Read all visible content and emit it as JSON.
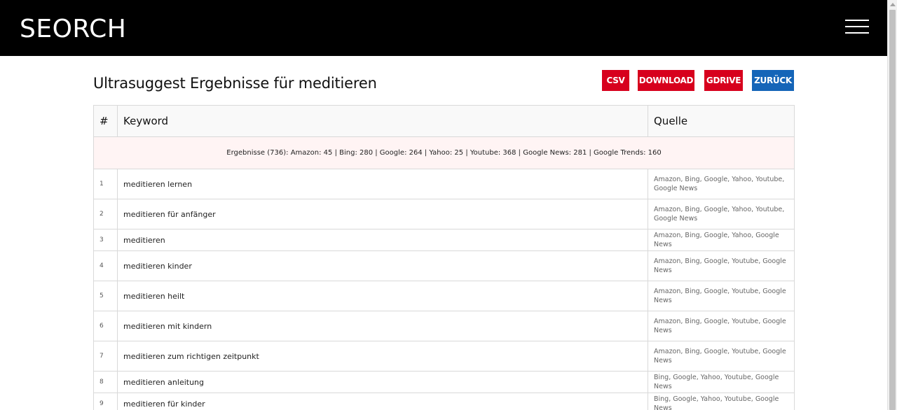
{
  "header": {
    "logo": "SEORCH",
    "menu_icon": "hamburger-menu-icon"
  },
  "main": {
    "title": "Ultrasuggest Ergebnisse für meditieren",
    "buttons": {
      "csv": "CSV",
      "download": "DOWNLOAD",
      "gdrive": "GDRIVE",
      "back": "ZURÜCK"
    },
    "colors": {
      "header_bg": "#000000",
      "button_red": "#d7001d",
      "button_blue": "#1565b8",
      "summary_bg": "#fff4f4"
    }
  },
  "table": {
    "headers": {
      "num": "#",
      "keyword": "Keyword",
      "source": "Quelle"
    },
    "summary": "Ergebnisse (736): Amazon: 45 | Bing: 280 | Google: 264 | Yahoo: 25 | Youtube: 368 | Google News: 281 | Google Trends: 160",
    "rows": [
      {
        "num": "1",
        "keyword": "meditieren lernen",
        "source": "Amazon, Bing, Google, Yahoo, Youtube, Google News"
      },
      {
        "num": "2",
        "keyword": "meditieren für anfänger",
        "source": "Amazon, Bing, Google, Yahoo, Youtube, Google News"
      },
      {
        "num": "3",
        "keyword": "meditieren",
        "source": "Amazon, Bing, Google, Yahoo, Google News"
      },
      {
        "num": "4",
        "keyword": "meditieren kinder",
        "source": "Amazon, Bing, Google, Youtube, Google News"
      },
      {
        "num": "5",
        "keyword": "meditieren heilt",
        "source": "Amazon, Bing, Google, Youtube, Google News"
      },
      {
        "num": "6",
        "keyword": "meditieren mit kindern",
        "source": "Amazon, Bing, Google, Youtube, Google News"
      },
      {
        "num": "7",
        "keyword": "meditieren zum richtigen zeitpunkt",
        "source": "Amazon, Bing, Google, Youtube, Google News"
      },
      {
        "num": "8",
        "keyword": "meditieren anleitung",
        "source": "Bing, Google, Yahoo, Youtube, Google News"
      },
      {
        "num": "9",
        "keyword": "meditieren für kinder",
        "source": "Bing, Google, Yahoo, Youtube, Google News"
      }
    ]
  }
}
